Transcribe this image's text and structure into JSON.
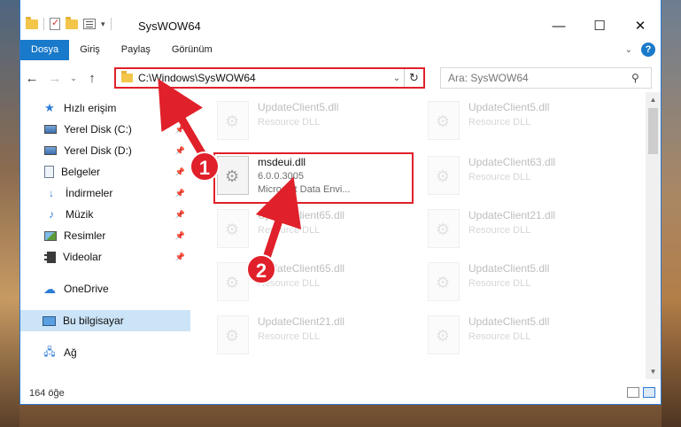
{
  "window": {
    "title": "SysWOW64"
  },
  "window_controls": {
    "minimize": "—",
    "maximize": "☐",
    "close": "✕"
  },
  "ribbon": {
    "tabs": [
      {
        "label": "Dosya",
        "active": true
      },
      {
        "label": "Giriş"
      },
      {
        "label": "Paylaş"
      },
      {
        "label": "Görünüm"
      }
    ],
    "help": "?"
  },
  "nav": {
    "back": "←",
    "forward": "→",
    "recent": "⌄",
    "up": "↑",
    "address": "C:\\Windows\\SysWOW64",
    "search_placeholder": "Ara: SysWOW64"
  },
  "sidebar": {
    "items": [
      {
        "label": "Hızlı erişim",
        "icon": "star-icon"
      },
      {
        "label": "Yerel Disk (C:)",
        "icon": "drive-icon",
        "pinned": true
      },
      {
        "label": "Yerel Disk (D:)",
        "icon": "drive-icon",
        "pinned": true
      },
      {
        "label": "Belgeler",
        "icon": "documents-icon",
        "pinned": true
      },
      {
        "label": "İndirmeler",
        "icon": "download-icon",
        "pinned": true
      },
      {
        "label": "Müzik",
        "icon": "music-icon",
        "pinned": true
      },
      {
        "label": "Resimler",
        "icon": "pictures-icon",
        "pinned": true
      },
      {
        "label": "Videolar",
        "icon": "videos-icon",
        "pinned": true
      },
      {
        "label": "OneDrive",
        "icon": "cloud-icon"
      },
      {
        "label": "Bu bilgisayar",
        "icon": "computer-icon",
        "selected": true
      },
      {
        "label": "Ağ",
        "icon": "network-icon"
      }
    ]
  },
  "files": [
    {
      "name": "UpdateClient5.dll",
      "sub": "Resource DLL"
    },
    {
      "name": "UpdateClient5.dll",
      "sub": "Resource DLL"
    },
    {
      "name": "msdeui.dll",
      "version": "6.0.0.3005",
      "sub": "Microsoft Data Envi..."
    },
    {
      "name": "UpdateClient63.dll",
      "sub": "Resource DLL"
    },
    {
      "name": "UpdateClient65.dll",
      "sub": "Resource DLL"
    },
    {
      "name": "UpdateClient21.dll",
      "sub": "Resource DLL"
    },
    {
      "name": "UpdateClient65.dll",
      "sub": "Resource DLL"
    },
    {
      "name": "UpdateClient5.dll",
      "sub": "Resource DLL"
    },
    {
      "name": "UpdateClient21.dll",
      "sub": "Resource DLL"
    },
    {
      "name": "UpdateClient5.dll",
      "sub": "Resource DLL"
    }
  ],
  "status": {
    "count": "164 öğe"
  },
  "annotations": {
    "step1": "1",
    "step2": "2",
    "color": "#e0202a"
  }
}
